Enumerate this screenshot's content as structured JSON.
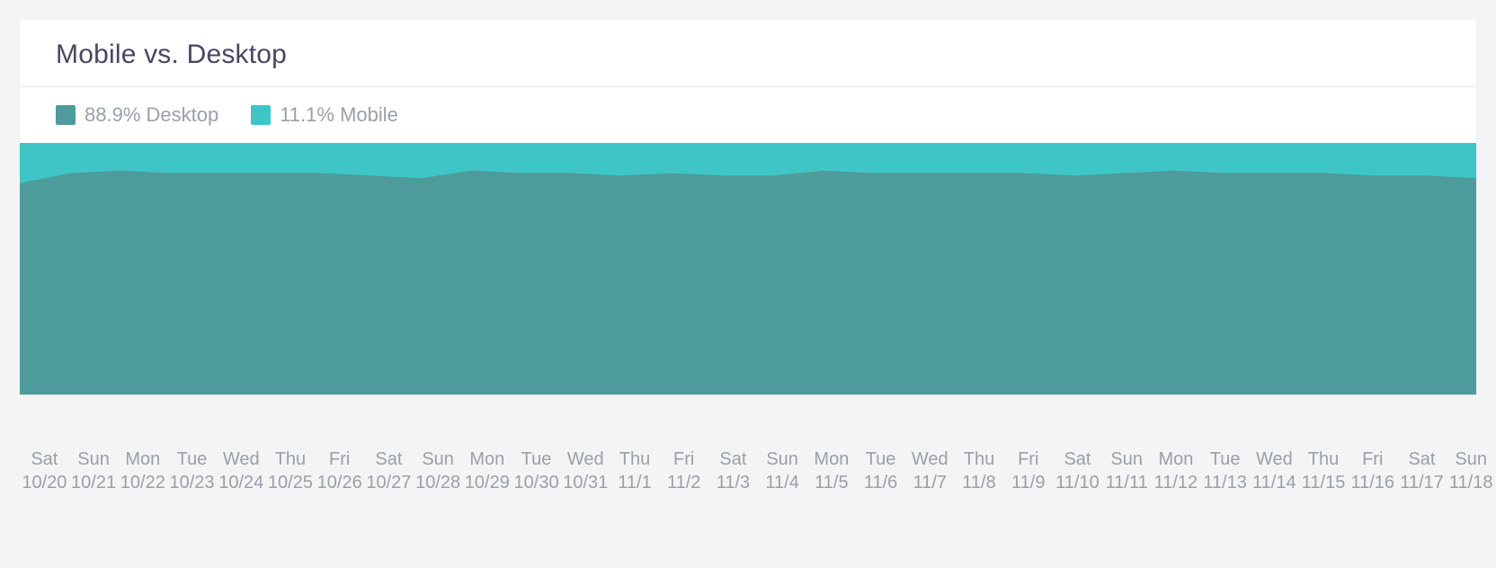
{
  "title": "Mobile vs. Desktop",
  "legend": [
    {
      "label": "88.9% Desktop",
      "color": "#4E9B9B"
    },
    {
      "label": "11.1% Mobile",
      "color": "#3EC6C6"
    }
  ],
  "colors": {
    "desktop": "#4E9B9B",
    "mobile": "#3EC6C6"
  },
  "chart_data": {
    "type": "area",
    "title": "Mobile vs. Desktop",
    "xlabel": "",
    "ylabel": "",
    "ylim": [
      0,
      100
    ],
    "categories_day": [
      "Sat",
      "Sun",
      "Mon",
      "Tue",
      "Wed",
      "Thu",
      "Fri",
      "Sat",
      "Sun",
      "Mon",
      "Tue",
      "Wed",
      "Thu",
      "Fri",
      "Sat",
      "Sun",
      "Mon",
      "Tue",
      "Wed",
      "Thu",
      "Fri",
      "Sat",
      "Sun",
      "Mon",
      "Tue",
      "Wed",
      "Thu",
      "Fri",
      "Sat",
      "Sun"
    ],
    "categories_date": [
      "10/20",
      "10/21",
      "10/22",
      "10/23",
      "10/24",
      "10/25",
      "10/26",
      "10/27",
      "10/28",
      "10/29",
      "10/30",
      "10/31",
      "11/1",
      "11/2",
      "11/3",
      "11/4",
      "11/5",
      "11/6",
      "11/7",
      "11/8",
      "11/9",
      "11/10",
      "11/11",
      "11/12",
      "11/13",
      "11/14",
      "11/15",
      "11/16",
      "11/17",
      "11/18"
    ],
    "series": [
      {
        "name": "Desktop",
        "color": "#4E9B9B",
        "values": [
          84,
          88,
          89,
          88,
          88,
          88,
          88,
          87,
          86,
          89,
          88,
          88,
          87,
          88,
          87,
          87,
          89,
          88,
          88,
          88,
          88,
          87,
          88,
          89,
          88,
          88,
          88,
          87,
          87,
          86
        ]
      },
      {
        "name": "Mobile",
        "color": "#3EC6C6",
        "values": [
          16,
          12,
          11,
          12,
          12,
          12,
          12,
          13,
          14,
          11,
          12,
          12,
          13,
          12,
          13,
          13,
          11,
          12,
          12,
          12,
          12,
          13,
          12,
          11,
          12,
          12,
          12,
          13,
          13,
          14
        ]
      }
    ],
    "note": "Stacked 100% area; Desktop + Mobile = 100 at every point."
  }
}
